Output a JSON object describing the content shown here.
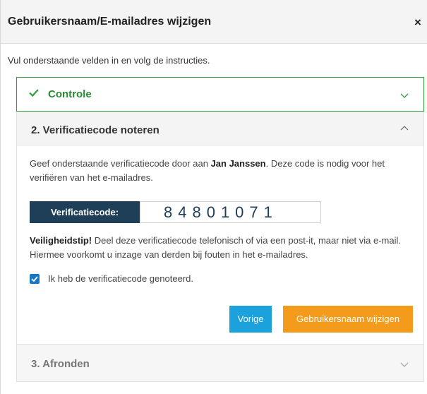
{
  "modal": {
    "title": "Gebruikersnaam/E-mailadres wijzigen",
    "close_symbol": "×",
    "intro": "Vul onderstaande velden in en volg de instructies."
  },
  "steps": {
    "step1": {
      "label": "Controle",
      "status": "completed",
      "expanded": false
    },
    "step2": {
      "label": "2. Verificatiecode noteren",
      "expanded": true,
      "desc_prefix": "Geef onderstaande verificatiecode door aan ",
      "desc_name": "Jan Janssen",
      "desc_suffix": ". Deze code is nodig voor het verifiëren van het e-mailadres.",
      "code_label": "Verificatiecode:",
      "code_value": "84801071",
      "tip_bold": "Veiligheidstip!",
      "tip_text": " Deel deze verificatiecode telefonisch of via een post-it, maar niet via e-mail. Hiermee voorkomt u inzage van derden bij fouten in het e-mailadres.",
      "checkbox_label": "Ik heb de verificatiecode genoteerd.",
      "checkbox_checked": true,
      "prev_button": "Vorige",
      "next_button": "Gebruikersnaam wijzigen"
    },
    "step3": {
      "label": "3. Afronden",
      "expanded": false
    }
  },
  "icons": {
    "step1_check": "check-icon",
    "step1_chevron": "chevron-down-icon",
    "step2_chevron": "chevron-up-icon",
    "step3_chevron": "chevron-down-icon",
    "checkbox": "checkbox-checked-icon"
  },
  "colors": {
    "success": "#2f9e3a",
    "code_label_bg": "#1f3e57",
    "primary_button": "#1ba1dc",
    "accent_button": "#f59b1c",
    "checkbox": "#1877c9"
  }
}
